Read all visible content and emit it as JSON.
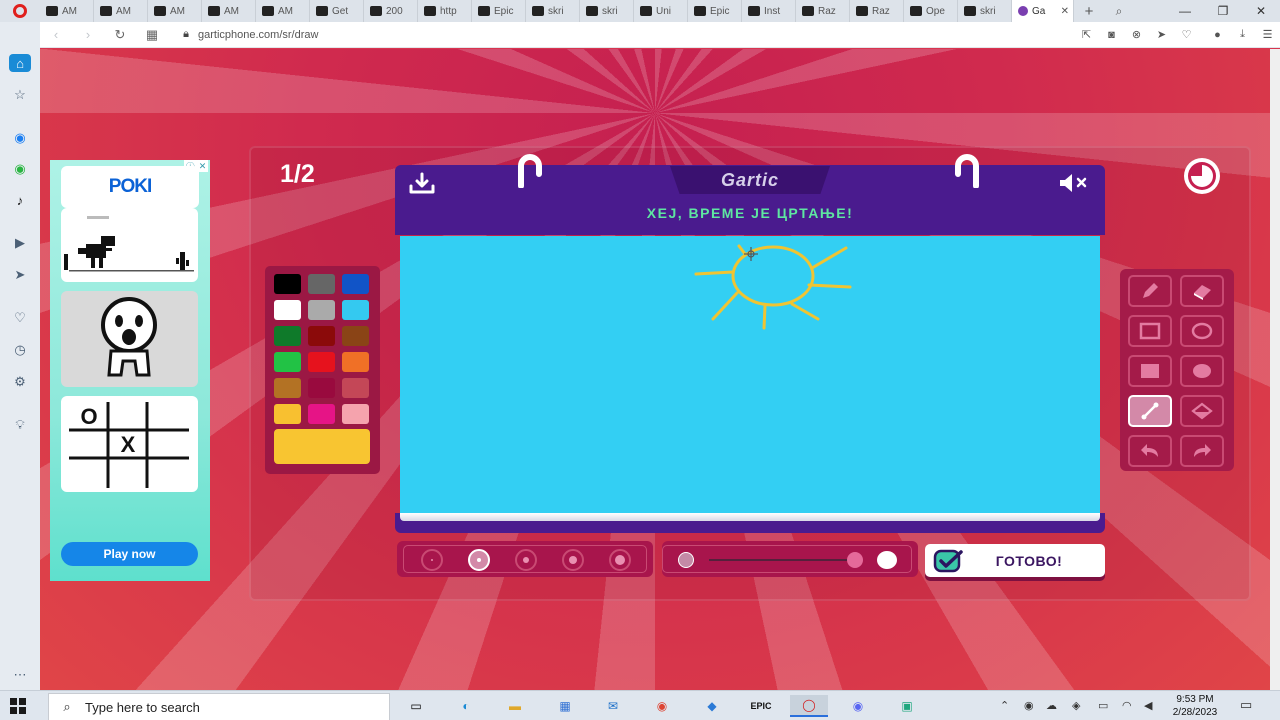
{
  "browser": {
    "tabs": [
      {
        "label": "AM",
        "icon": "am-logo-icon"
      },
      {
        "label": "AM",
        "icon": "am-logo-icon"
      },
      {
        "label": "AM",
        "icon": "am-logo-icon"
      },
      {
        "label": "AM",
        "icon": "am-logo-icon"
      },
      {
        "label": "AM",
        "icon": "am-logo-icon"
      },
      {
        "label": "Get",
        "icon": "meta-icon"
      },
      {
        "label": "200",
        "icon": "swirl-icon"
      },
      {
        "label": "http",
        "icon": "page-icon"
      },
      {
        "label": "Epic",
        "icon": "epic-icon"
      },
      {
        "label": "skri",
        "icon": "skribbl-icon"
      },
      {
        "label": "skri",
        "icon": "skribbl-icon"
      },
      {
        "label": "Uni",
        "icon": "uni-icon"
      },
      {
        "label": "Epic",
        "icon": "epic-icon"
      },
      {
        "label": "Inst",
        "icon": "shield-icon"
      },
      {
        "label": "Raz",
        "icon": "razer-icon"
      },
      {
        "label": "Raz",
        "icon": "razer-icon"
      },
      {
        "label": "Ope",
        "icon": "opera-icon"
      },
      {
        "label": "skri",
        "icon": "skribbl-icon"
      }
    ],
    "active_tab": {
      "label": "Ga",
      "icon": "gartic-icon"
    },
    "url": "garticphone.com/sr/draw"
  },
  "ad": {
    "brand": "POKI",
    "cta": "Play now",
    "ttt_marks": [
      "O",
      "X"
    ]
  },
  "game": {
    "round": "1/2",
    "logo": "Gartic",
    "title": "ХЕЈ, ВРЕМЕ ЈЕ ЦРТАЊЕ!",
    "done_label": "ГОТОВО!",
    "palette": [
      "#000000",
      "#666666",
      "#1154c7",
      "#ffffff",
      "#aaaaaa",
      "#34c9f0",
      "#0f7a2a",
      "#8b0a0a",
      "#8a4416",
      "#22c245",
      "#e6121d",
      "#f07026",
      "#b37224",
      "#990a3e",
      "#c44757",
      "#f8c030",
      "#e61486",
      "#f5a3ad"
    ],
    "current_color": "#f8c531",
    "canvas_color": "#33cff3",
    "tools": [
      {
        "name": "pencil-icon",
        "active": false
      },
      {
        "name": "eraser-icon",
        "active": false
      },
      {
        "name": "rectangle-outline-icon",
        "active": false
      },
      {
        "name": "ellipse-outline-icon",
        "active": false
      },
      {
        "name": "rectangle-filled-icon",
        "active": false
      },
      {
        "name": "ellipse-filled-icon",
        "active": false
      },
      {
        "name": "line-icon",
        "active": true
      },
      {
        "name": "fill-bucket-icon",
        "active": false
      },
      {
        "name": "undo-icon",
        "active": false
      },
      {
        "name": "redo-icon",
        "active": false
      }
    ],
    "thickness_selected": 2,
    "thickness_count": 5
  },
  "taskbar": {
    "search_placeholder": "Type here to search",
    "time": "9:53 PM",
    "date": "2/28/2023"
  }
}
